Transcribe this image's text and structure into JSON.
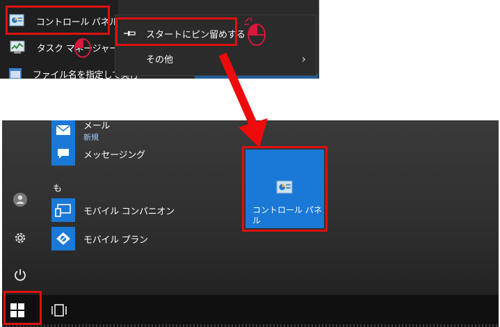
{
  "top_menu": {
    "list": [
      {
        "label": "コントロール パネル",
        "icon": "control-panel-icon"
      },
      {
        "label": "タスク マネージャー",
        "icon": "task-manager-icon"
      },
      {
        "label": "ファイル名を指定して実行",
        "icon": "run-icon"
      }
    ],
    "context_menu": {
      "pin_label": "スタートにピン留めする",
      "other_label": "その他",
      "chevron": "›"
    }
  },
  "start_menu": {
    "apps": [
      {
        "label": "メール",
        "sub": "新規",
        "icon": "mail-icon"
      },
      {
        "label": "メッセージング",
        "icon": "messaging-icon"
      },
      {
        "label": "モバイル コンパニオン",
        "icon": "mobile-companion-icon"
      },
      {
        "label": "モバイル プラン",
        "icon": "mobile-plans-icon"
      }
    ],
    "section_letter": "も",
    "pinned_tile_label": "コントロール パネル",
    "rail_icons": [
      "user-icon",
      "settings-icon",
      "power-icon"
    ]
  },
  "colors": {
    "accent_blue": "#1a78d6",
    "highlight_red": "#e01010",
    "menu_bg": "#2b2b2b"
  }
}
